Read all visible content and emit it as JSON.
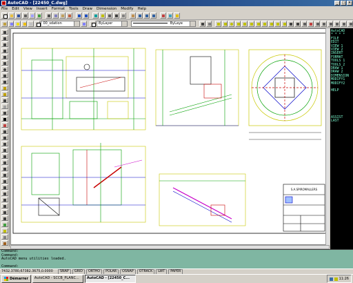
{
  "window": {
    "title": "AutoCAD - [22450_C.dwg]",
    "buttons": [
      "_",
      "□",
      "×"
    ]
  },
  "menu": [
    "File",
    "Edit",
    "View",
    "Insert",
    "Format",
    "Tools",
    "Draw",
    "Dimension",
    "Modify",
    "Help"
  ],
  "toolbar": {
    "layer_value": "00_sdation",
    "color_value": "ByLayer",
    "linetype_value": "ByLaye"
  },
  "screen_menu": {
    "title": "AutoCAD",
    "separator": "* * * *",
    "items": [
      "FILE",
      "EDIT",
      "VIEW 1",
      "VIEW 2",
      "INSERT",
      "FORMAT",
      "TOOLS 1",
      "TOOLS 2",
      "DRAW 1",
      "DRAW 2",
      "DIMENSION",
      "MODIFY1",
      "MODIFY2"
    ],
    "help": "HELP",
    "assist": "ASSIST",
    "last": "LAST"
  },
  "command": {
    "lines": [
      "Command:",
      "Command:",
      "AutoCAD menu utilities loaded.",
      "",
      "Command:"
    ]
  },
  "status": {
    "coords": "7432.3780,67382.3675,0.0000",
    "modes": [
      "SNAP",
      "GRID",
      "ORTHO",
      "POLAR",
      "OSNAP",
      "OTRACK",
      "LWT",
      "PAPER"
    ]
  },
  "taskbar": {
    "start": "Démarrer",
    "tasks": [
      "AutoCAD - SCCB_PLANC...",
      "AutoCAD - [22450_C..."
    ],
    "clock": "11:26"
  },
  "drawing": {
    "company": "S.A.SPIROMALLERS",
    "colors": {
      "yellow": "#c8c800",
      "green": "#00a000",
      "blue": "#0000c8",
      "red": "#c80000",
      "magenta": "#c800c8",
      "cyan": "#00b0b0"
    }
  }
}
